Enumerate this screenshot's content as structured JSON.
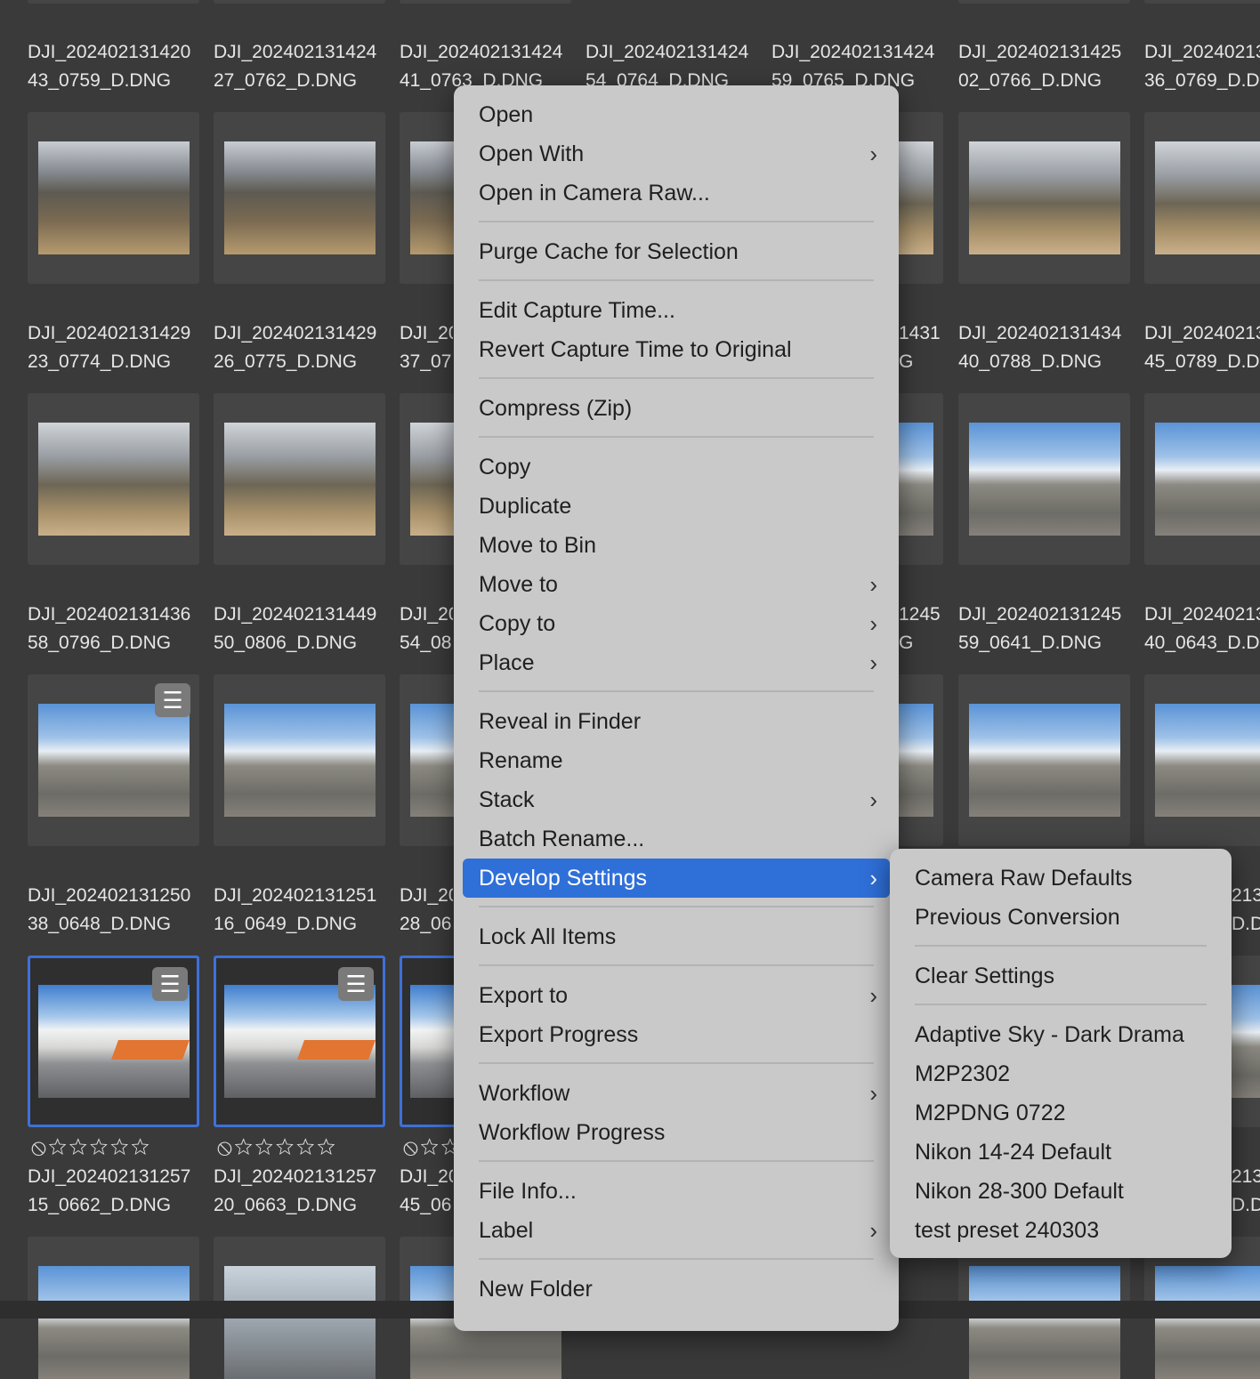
{
  "grid": {
    "rows": [
      {
        "names": [
          [
            "DJI_202402131420",
            "43_0759_D.DNG"
          ],
          [
            "DJI_202402131424",
            "27_0762_D.DNG"
          ],
          [
            "DJI_202402131424",
            "41_0763_D.DNG"
          ],
          [
            "DJI_202402131424",
            "54_0764_D.DNG"
          ],
          [
            "DJI_202402131424",
            "59_0765_D.DNG"
          ],
          [
            "DJI_202402131425",
            "02_0766_D.DNG"
          ],
          [
            "DJI_20240213",
            "36_0769_D.D"
          ]
        ]
      },
      {
        "names": [
          [
            "DJI_202402131429",
            "23_0774_D.DNG"
          ],
          [
            "DJI_202402131429",
            "26_0775_D.DNG"
          ],
          [
            "DJI_20",
            "37_07"
          ],
          [
            "",
            ""
          ],
          [
            "1431",
            "G"
          ],
          [
            "DJI_202402131434",
            "40_0788_D.DNG"
          ],
          [
            "DJI_20240213",
            "45_0789_D.D"
          ]
        ]
      },
      {
        "names": [
          [
            "DJI_202402131436",
            "58_0796_D.DNG"
          ],
          [
            "DJI_202402131449",
            "50_0806_D.DNG"
          ],
          [
            "DJI_20",
            "54_08"
          ],
          [
            "",
            ""
          ],
          [
            "1245",
            "G"
          ],
          [
            "DJI_202402131245",
            "59_0641_D.DNG"
          ],
          [
            "DJI_20240213",
            "40_0643_D.D"
          ]
        ]
      },
      {
        "names": [
          [
            "DJI_202402131250",
            "38_0648_D.DNG"
          ],
          [
            "DJI_202402131251",
            "16_0649_D.DNG"
          ],
          [
            "DJI_20",
            "28_06"
          ],
          [
            "",
            ""
          ],
          [
            "",
            ""
          ],
          [
            "",
            ""
          ],
          [
            "213",
            "D.D"
          ]
        ]
      },
      {
        "names": [
          [
            "DJI_202402131257",
            "15_0662_D.DNG"
          ],
          [
            "DJI_202402131257",
            "20_0663_D.DNG"
          ],
          [
            "DJI_20",
            "45_06"
          ],
          [
            "",
            ""
          ],
          [
            "",
            ""
          ],
          [
            "",
            ""
          ],
          [
            "213",
            "D.D"
          ]
        ]
      }
    ],
    "rating_stars": "☆☆☆☆☆",
    "reject_symbol": "⃠"
  },
  "context_menu": {
    "items": [
      {
        "label": "Open"
      },
      {
        "label": "Open With",
        "submenu": true
      },
      {
        "label": "Open in Camera Raw..."
      },
      {
        "label": "Purge Cache for Selection"
      },
      {
        "label": "Edit Capture Time..."
      },
      {
        "label": "Revert Capture Time to Original"
      },
      {
        "label": "Compress (Zip)"
      },
      {
        "label": "Copy"
      },
      {
        "label": "Duplicate"
      },
      {
        "label": "Move to Bin"
      },
      {
        "label": "Move to",
        "submenu": true
      },
      {
        "label": "Copy to",
        "submenu": true
      },
      {
        "label": "Place",
        "submenu": true
      },
      {
        "label": "Reveal in Finder"
      },
      {
        "label": "Rename"
      },
      {
        "label": "Stack",
        "submenu": true
      },
      {
        "label": "Batch Rename..."
      },
      {
        "label": "Develop Settings",
        "submenu": true,
        "highlighted": true
      },
      {
        "label": "Lock All Items"
      },
      {
        "label": "Export to",
        "submenu": true
      },
      {
        "label": "Export Progress"
      },
      {
        "label": "Workflow",
        "submenu": true
      },
      {
        "label": "Workflow Progress"
      },
      {
        "label": "File Info..."
      },
      {
        "label": "Label",
        "submenu": true
      },
      {
        "label": "New Folder"
      }
    ]
  },
  "develop_submenu": {
    "items": [
      "Camera Raw Defaults",
      "Previous Conversion",
      "Clear Settings",
      "Adaptive Sky - Dark Drama",
      "M2P2302",
      "M2PDNG 0722",
      "Nikon 14-24 Default",
      "Nikon 28-300 Default",
      "test preset 240303"
    ]
  },
  "icons": {
    "chevron": "chevron-right-icon",
    "adjust": "sliders-icon",
    "reject": "reject-icon",
    "star": "star-outline-icon"
  },
  "colors": {
    "highlight": "#2f6fd8",
    "selection_border": "#3e71d8",
    "menu_bg": "#c9c9c9",
    "grid_bg": "#3a3a3a"
  }
}
